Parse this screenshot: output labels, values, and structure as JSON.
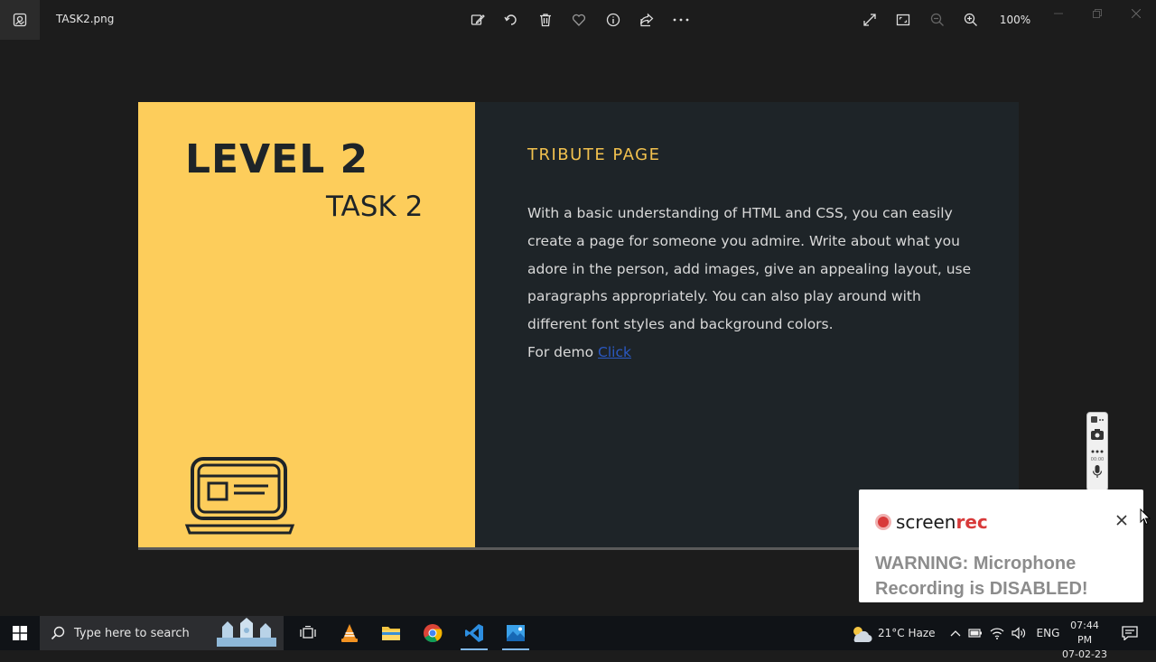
{
  "window": {
    "file_name": "TASK2.png",
    "zoom": "100%"
  },
  "toolbar": {
    "icons": [
      "edit-image-icon",
      "rotate-icon",
      "delete-icon",
      "favorite-icon",
      "info-icon",
      "share-icon",
      "more-icon"
    ]
  },
  "image": {
    "level_title": "LEVEL 2",
    "task_title": "TASK 2",
    "heading": "TRIBUTE PAGE",
    "paragraph": "With a basic understanding of HTML and CSS, you can easily create a page for someone you admire. Write about what you adore in the person, add images, give an appealing layout, use paragraphs appropriately. You can also play around with different font styles and background colors.",
    "demo_prefix": "For demo",
    "demo_link": "Click",
    "colors": {
      "left_bg": "#fdcd5b",
      "right_bg": "#1e2428",
      "heading": "#f2c14e",
      "link": "#2b59c3"
    }
  },
  "screenrec": {
    "logo_a": "screen",
    "logo_b": "rec",
    "warning": "WARNING: Microphone Recording is DISABLED!",
    "bar_time": "00:00"
  },
  "taskbar": {
    "search_placeholder": "Type here to search",
    "weather": "21°C  Haze",
    "language": "ENG",
    "time": "07:44 PM",
    "date": "07-02-23"
  }
}
